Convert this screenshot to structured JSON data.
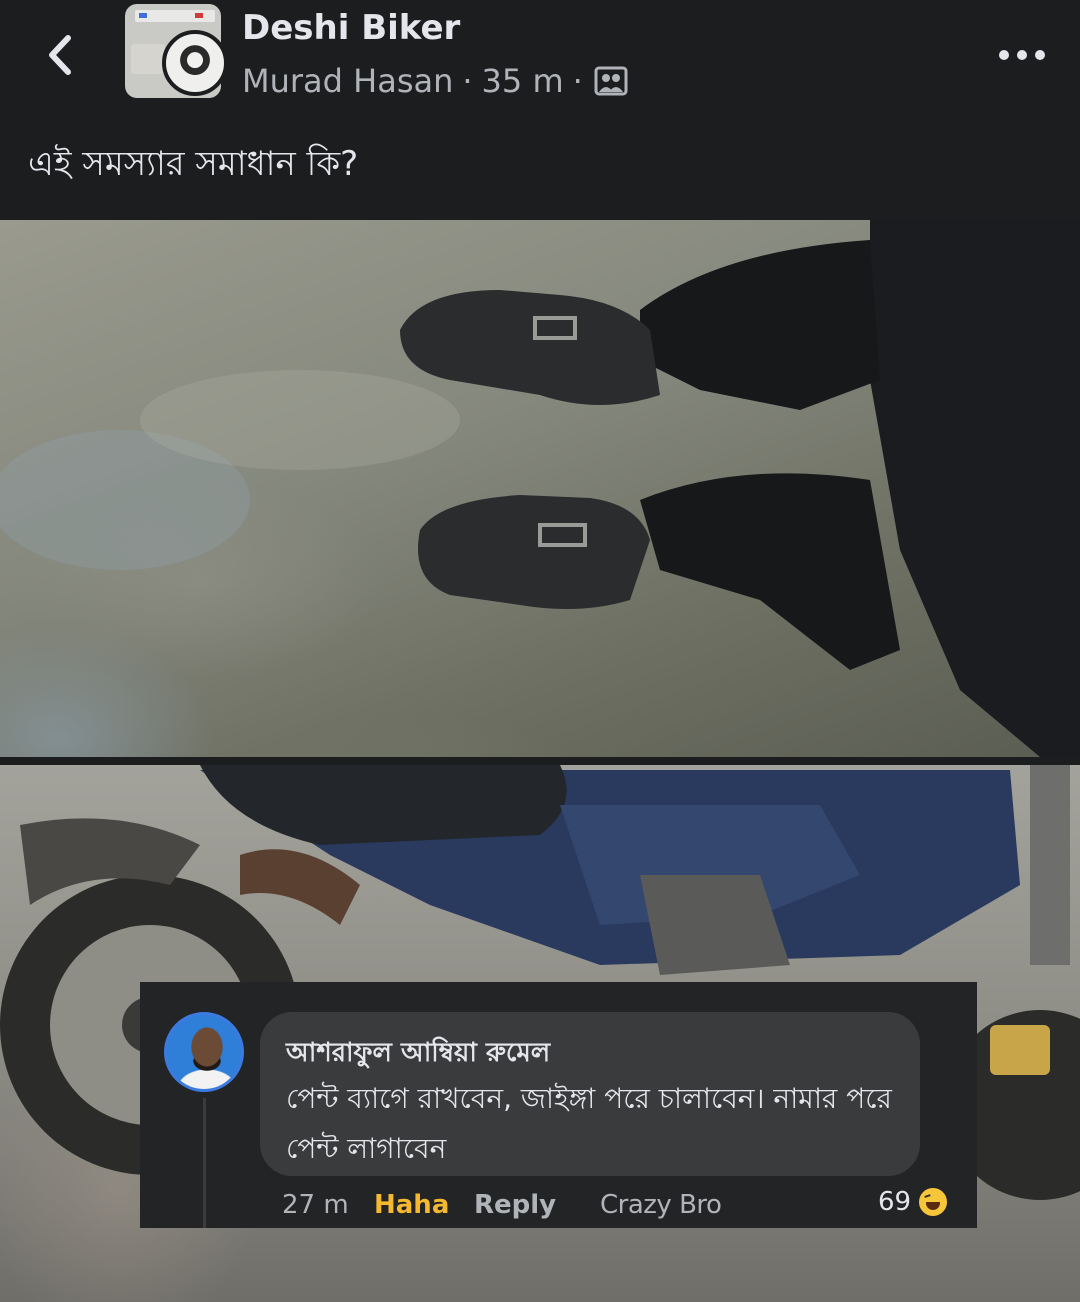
{
  "header": {
    "group_name": "Deshi Biker",
    "author": "Murad Hasan",
    "separator": "·",
    "time": "35 m",
    "back_icon": "chevron-left-icon",
    "audience_icon": "group-members-icon",
    "more_icon": "more-options-icon"
  },
  "post": {
    "text": "এই সমস্যার সমাধান কি?"
  },
  "comment": {
    "author": "আশরাফুল আম্বিয়া রুমেল",
    "text": "পেন্ট ব্যাগে রাখবেন, জাইঙ্গা পরে চালাবেন। নামার পরে পেন্ট লাগাবেন",
    "time": "27 m",
    "reaction_label": "Haha",
    "reply_label": "Reply",
    "badge_text": "Crazy Bro",
    "reaction_count": "69",
    "reaction_icon": "haha-emoji-icon",
    "colors": {
      "haha": "#f5b82e",
      "bubble": "#3a3b3c"
    }
  },
  "theme": {
    "background": "#1c1d1f",
    "text": "#e4e6eb",
    "secondary": "#b0b3b8"
  }
}
